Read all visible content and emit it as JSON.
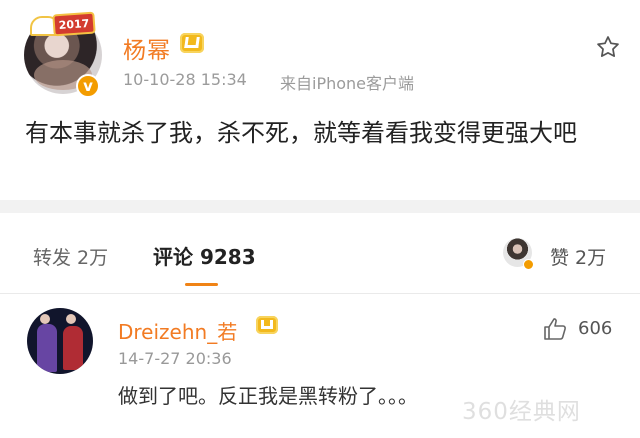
{
  "post": {
    "username": "杨幂",
    "timestamp": "10-10-28 15:34",
    "source": "来自iPhone客户端",
    "text": "有本事就杀了我，杀不死，就等着看我变得更强大吧",
    "avatar_badge_text": "2017"
  },
  "tabs": {
    "repost": "转发 2万",
    "comments": "评论 9283",
    "likes": "赞 2万"
  },
  "comment": {
    "username": "Dreizehn_若",
    "timestamp": "14-7-27 20:36",
    "text": "做到了吧。反正我是黑转粉了。。。",
    "like_count": "606"
  },
  "watermark": "360经典网",
  "colors": {
    "accent_orange": "#f27b23",
    "tab_underline": "#f08316",
    "verified": "#f39c00",
    "vip_gold": "#f2b91d"
  },
  "icons": {
    "favorite": "star-icon",
    "verified": "verified-badge-icon",
    "vip": "vip-crown-icon",
    "like": "thumbs-up-icon"
  }
}
